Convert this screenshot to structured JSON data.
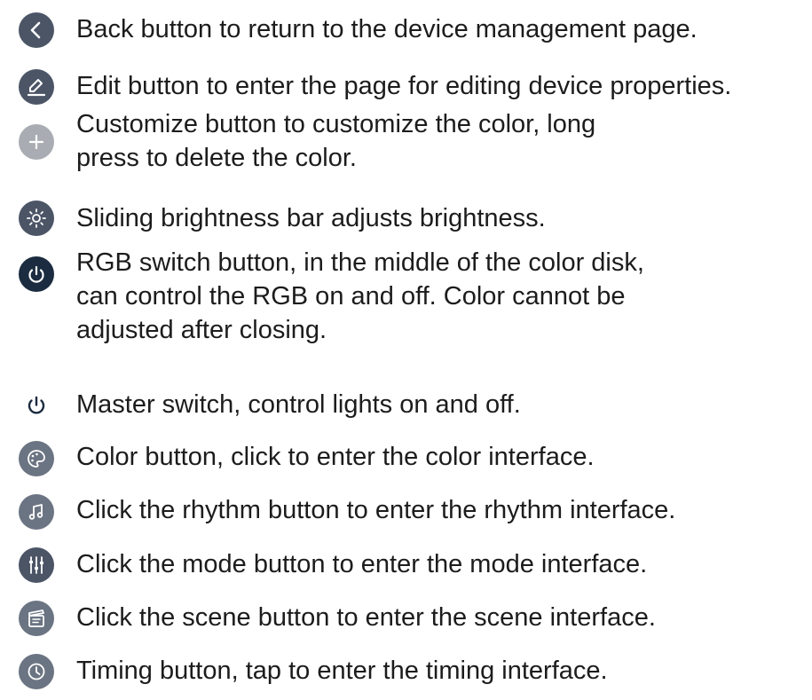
{
  "items": [
    {
      "icon": "chevron-left-icon",
      "color": "#4b5566",
      "lines": [
        "Back button to return to the device management page."
      ]
    },
    {
      "icon": "edit-pencil-icon",
      "color": "#4b5566",
      "lines": [
        "Edit button to enter the page for editing device properties."
      ]
    },
    {
      "icon": "plus-icon",
      "color": "#a9adb3",
      "lines": [
        "Customize button to customize the color, long",
        "press to delete the color."
      ]
    },
    {
      "icon": "sun-brightness-icon",
      "color": "#4b5566",
      "lines": [
        "Sliding brightness bar adjusts brightness."
      ]
    },
    {
      "icon": "power-icon",
      "color": "#1b2b40",
      "lines": [
        "RGB switch button, in the middle of the color disk,",
        "can control the RGB on and off. Color cannot be",
        "adjusted after closing."
      ]
    },
    {
      "icon": "power-icon",
      "color": "#1b2b40",
      "lines": [
        "Master switch, control lights on and off."
      ]
    },
    {
      "icon": "palette-icon",
      "color": "#6b7482",
      "lines": [
        "Color button, click to enter the color interface."
      ]
    },
    {
      "icon": "music-note-icon",
      "color": "#6b7482",
      "lines": [
        "Click the rhythm button to enter the rhythm interface."
      ]
    },
    {
      "icon": "sliders-icon",
      "color": "#4b5566",
      "lines": [
        "Click the mode button to enter the mode interface."
      ]
    },
    {
      "icon": "clapperboard-icon",
      "color": "#6b7482",
      "lines": [
        "Click the scene button to enter the scene interface."
      ]
    },
    {
      "icon": "clock-icon",
      "color": "#6b7482",
      "lines": [
        "Timing button, tap to enter the timing interface."
      ]
    }
  ]
}
